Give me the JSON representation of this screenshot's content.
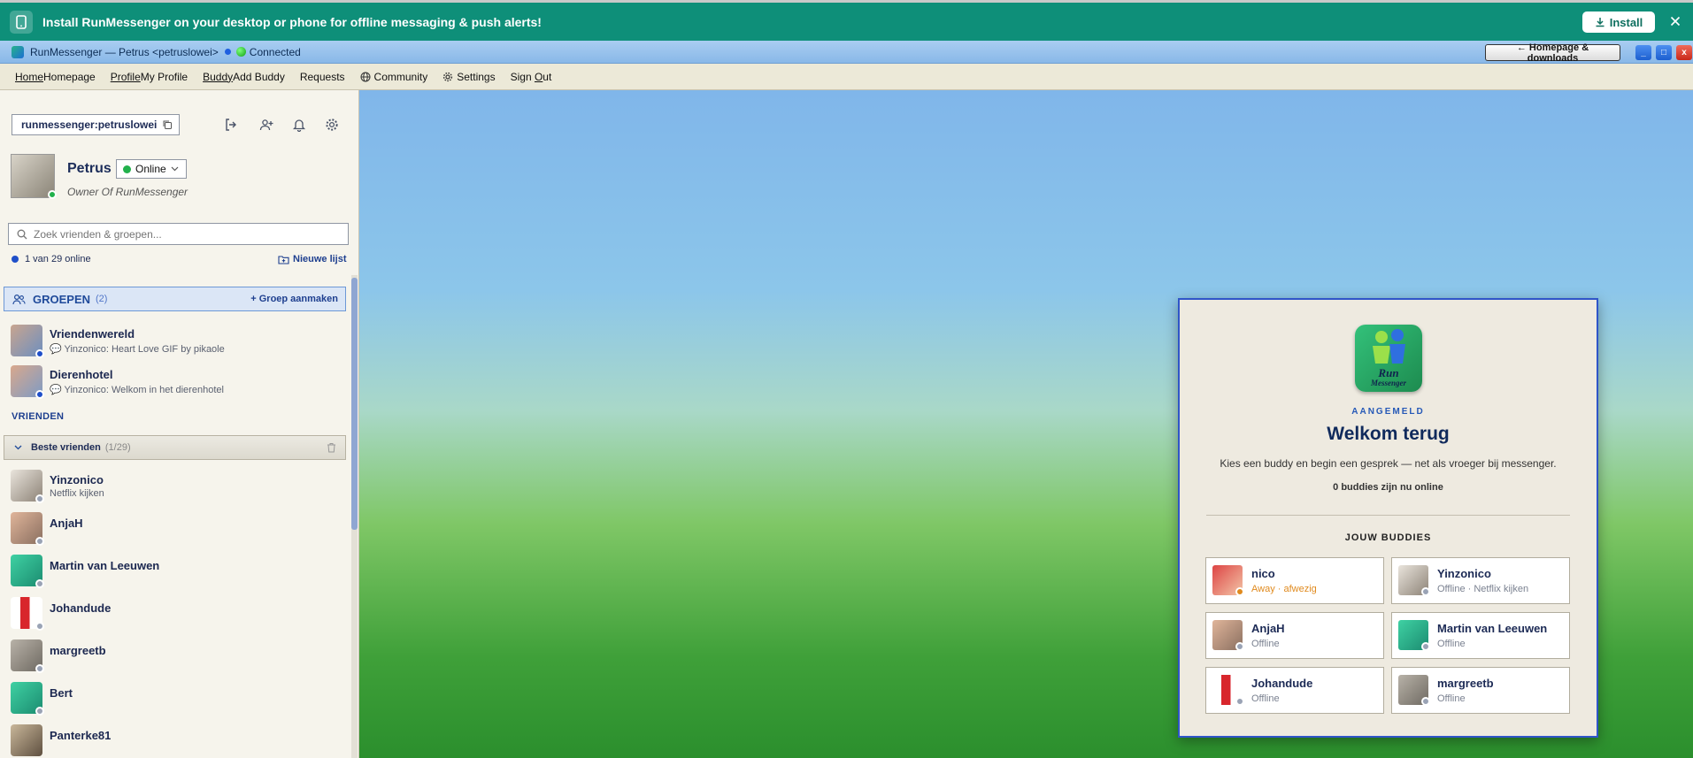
{
  "banner": {
    "text": "Install RunMessenger on your desktop or phone for offline messaging & push alerts!",
    "install_label": "Install",
    "close_label": "×"
  },
  "titlebar": {
    "title": "RunMessenger — Petrus <petruslowei>",
    "connection": "Connected",
    "homepage_label": "← Homepage & downloads",
    "min_label": "_",
    "max_label": "□",
    "close_label": "x"
  },
  "menu": {
    "home": {
      "key": "Home",
      "rest": "Homepage"
    },
    "profile": {
      "key": "Profile",
      "rest": "My Profile"
    },
    "buddy": {
      "key": "Buddy",
      "rest": "Add Buddy"
    },
    "requests": "Requests",
    "community": "Community",
    "settings": "Settings",
    "signout": {
      "pre": "Sign ",
      "key": "O",
      "post": "ut"
    }
  },
  "sidebar": {
    "user_id": "runmessenger:petruslowei",
    "profile": {
      "name": "Petrus",
      "status": "Online",
      "tagline": "Owner Of RunMessenger"
    },
    "search_placeholder": "Zoek vrienden & groepen...",
    "online_count": "1 van 29 online",
    "new_list_label": "Nieuwe lijst",
    "groups": {
      "title": "GROEPEN",
      "count": "(2)",
      "create_label": "+ Groep aanmaken",
      "items": [
        {
          "name": "Vriendenwereld",
          "last": "💬 Yinzonico: Heart Love GIF by pikaole"
        },
        {
          "name": "Dierenhotel",
          "last": "💬 Yinzonico: Welkom in het dierenhotel"
        }
      ]
    },
    "friends_label": "VRIENDEN",
    "list": {
      "title": "Beste vrienden",
      "count": "(1/29)"
    },
    "friends": [
      {
        "name": "Yinzonico",
        "sub": "Netflix kijken"
      },
      {
        "name": "AnjaH",
        "sub": ""
      },
      {
        "name": "Martin van Leeuwen",
        "sub": ""
      },
      {
        "name": "Johandude",
        "sub": ""
      },
      {
        "name": "margreetb",
        "sub": ""
      },
      {
        "name": "Bert",
        "sub": ""
      },
      {
        "name": "Panterke81",
        "sub": ""
      }
    ]
  },
  "welcome": {
    "logo_line1": "Run",
    "logo_line2": "Messenger",
    "kicker": "AANGEMELD",
    "title": "Welkom terug",
    "tagline": "Kies een buddy en begin een gesprek — net als vroeger bij messenger.",
    "online_now": "0 buddies zijn nu online",
    "buddies_title": "JOUW BUDDIES",
    "buddies": [
      {
        "name": "nico",
        "status": "Away · afwezig"
      },
      {
        "name": "Yinzonico",
        "status": "Offline · Netflix kijken"
      },
      {
        "name": "AnjaH",
        "status": "Offline"
      },
      {
        "name": "Martin van Leeuwen",
        "status": "Offline"
      },
      {
        "name": "Johandude",
        "status": "Offline"
      },
      {
        "name": "margreetb",
        "status": "Offline"
      }
    ]
  },
  "colors": {
    "banner": "#0e8f79",
    "accent": "#1f4a9a",
    "online": "#22b14c",
    "away": "#e08a1e",
    "offline": "#9aa3b5"
  }
}
